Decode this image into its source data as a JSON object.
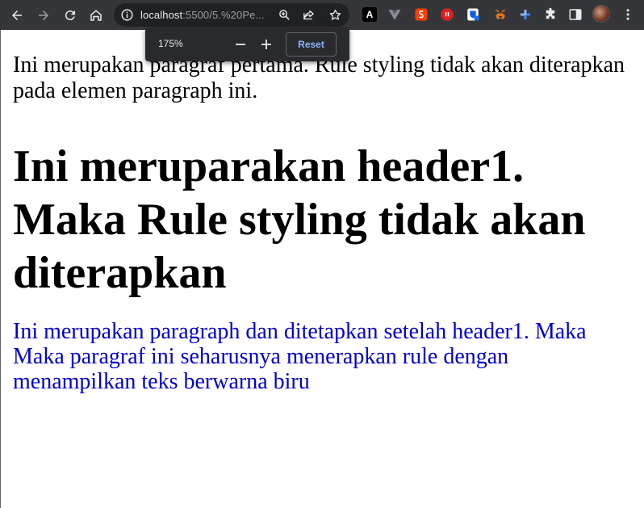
{
  "browser": {
    "url_host": "localhost",
    "url_rest": ":5500/5.%20Pe...",
    "icons": [
      "back-icon",
      "forward-icon",
      "reload-icon",
      "home-icon",
      "info-icon",
      "zoom-icon",
      "share-icon",
      "star-icon",
      "puzzle-icon",
      "sidebar-icon",
      "kebab-menu-icon"
    ],
    "extensions": {
      "angular_label": "A"
    }
  },
  "zoom_popup": {
    "level": "175%",
    "minus_label": "−",
    "plus_label": "+",
    "reset_label": "Reset"
  },
  "page": {
    "paragraph1": "Ini merupakan paragraf pertama. Rule styling tidak akan diterapkan pada elemen paragraph ini.",
    "heading1": "Ini meruparakan header1. Maka Rule styling tidak akan diterapkan",
    "paragraph2": "Ini merupakan paragraph dan ditetapkan setelah header1. Maka Maka paragraf ini seharusnya menerapkan rule dengan menampilkan teks berwarna biru",
    "paragraph2_color": "#0000cc"
  }
}
